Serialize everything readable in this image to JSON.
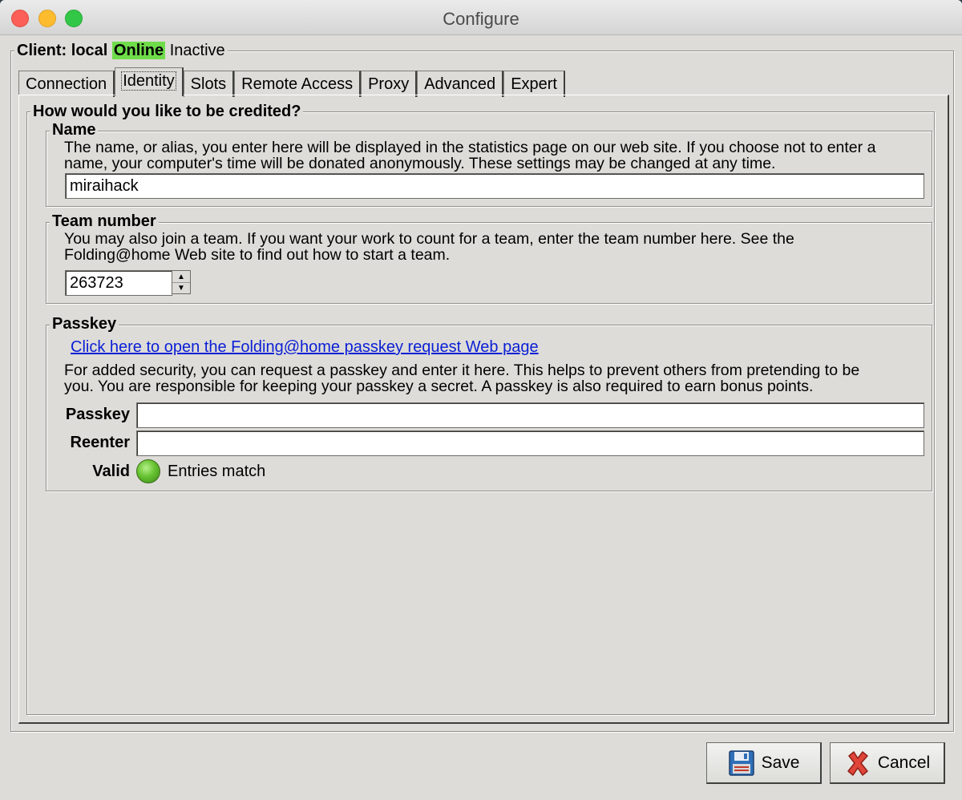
{
  "window": {
    "title": "Configure"
  },
  "client": {
    "label": "Client: local",
    "status_online": "Online",
    "status_activity": "Inactive"
  },
  "tabs": [
    {
      "label": "Connection"
    },
    {
      "label": "Identity",
      "active": true
    },
    {
      "label": "Slots"
    },
    {
      "label": "Remote Access"
    },
    {
      "label": "Proxy"
    },
    {
      "label": "Advanced"
    },
    {
      "label": "Expert"
    }
  ],
  "identity": {
    "heading": "How would you like to be credited?",
    "name": {
      "legend": "Name",
      "description_line1": "The name, or alias, you enter here will be displayed in the statistics page on our web site.  If you choose not to enter a",
      "description_line2": "name, your computer's time will be donated anonymously.  These settings may be changed at any time.",
      "value": "miraihack"
    },
    "team": {
      "legend": "Team number",
      "description_line1": "You may also join a team.  If you want your work to count for a team, enter the team number here.  See the",
      "description_line2": "Folding@home Web site to find out how to start a team.",
      "value": "263723"
    },
    "passkey": {
      "legend": "Passkey",
      "link_text": "Click here to open the Folding@home passkey request Web page",
      "description_line1": "For added security, you can request a passkey and enter it here.  This helps to prevent others from pretending to be",
      "description_line2": "you.  You are responsible for keeping your passkey a secret.  A passkey is also required to earn bonus points.",
      "passkey_label": "Passkey",
      "passkey_value": "",
      "reenter_label": "Reenter",
      "reenter_value": "",
      "valid_label": "Valid",
      "valid_status": "Entries match",
      "valid_color": "#66c230"
    }
  },
  "buttons": {
    "save": "Save",
    "cancel": "Cancel"
  },
  "colors": {
    "online_bg": "#6fdc4a",
    "link": "#0b1fd6",
    "window_bg": "#dddcd8"
  }
}
